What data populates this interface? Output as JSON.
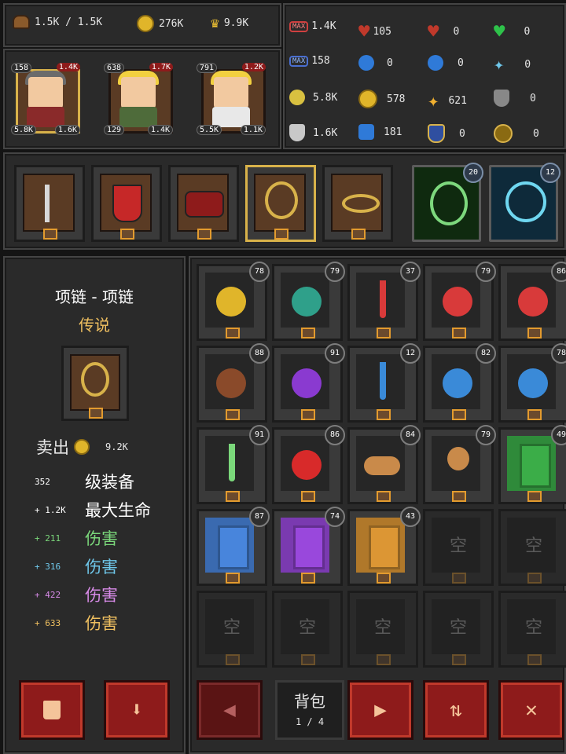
{
  "resources": {
    "capacity": "1.5K / 1.5K",
    "gold": "276K",
    "crown": "9.9K"
  },
  "heroes": [
    {
      "level": "158",
      "hp": "1.4K",
      "stat_left": "5.8K",
      "stat_right": "1.6K",
      "selected": true
    },
    {
      "level": "638",
      "hp": "1.7K",
      "stat_left": "129",
      "stat_right": "1.4K",
      "selected": false
    },
    {
      "level": "791",
      "hp": "1.2K",
      "stat_left": "5.5K",
      "stat_right": "1.1K",
      "selected": false
    }
  ],
  "stats": {
    "row1": [
      "1.4K",
      "105",
      "0",
      "0"
    ],
    "row2": [
      "158",
      "0",
      "0",
      "0"
    ],
    "row3": [
      "5.8K",
      "578",
      "621",
      "0"
    ],
    "row4": [
      "1.6K",
      "181",
      "0",
      "0"
    ]
  },
  "skills": [
    {
      "level": "20"
    },
    {
      "level": "12"
    }
  ],
  "detail": {
    "name": "项链 - 项链",
    "rarity": "传说",
    "sell_label": "卖出",
    "sell_value": "9.2K",
    "lines": [
      {
        "value": "352",
        "name": "级装备",
        "color": "#ffffff"
      },
      {
        "value": "+ 1.2K",
        "name": "最大生命",
        "color": "#ffffff"
      },
      {
        "value": "+ 211",
        "name": "伤害",
        "color": "#7bd87b"
      },
      {
        "value": "+ 316",
        "name": "伤害",
        "color": "#6fc7ea"
      },
      {
        "value": "+ 422",
        "name": "伤害",
        "color": "#d88be8"
      },
      {
        "value": "+ 633",
        "name": "伤害",
        "color": "#f0c060"
      }
    ]
  },
  "inventory": {
    "empty_label": "空",
    "bag_label": "背包",
    "page": "1 / 4",
    "items": [
      {
        "count": "78",
        "kind": "potion-yellow"
      },
      {
        "count": "79",
        "kind": "potion-teal"
      },
      {
        "count": "37",
        "kind": "tube-red"
      },
      {
        "count": "79",
        "kind": "potion-red"
      },
      {
        "count": "86",
        "kind": "flask-red"
      },
      {
        "count": "88",
        "kind": "potion-brown"
      },
      {
        "count": "91",
        "kind": "potion-purple"
      },
      {
        "count": "12",
        "kind": "tube-blue"
      },
      {
        "count": "82",
        "kind": "potion-blue"
      },
      {
        "count": "78",
        "kind": "flask-blue"
      },
      {
        "count": "91",
        "kind": "tube-green"
      },
      {
        "count": "86",
        "kind": "apple"
      },
      {
        "count": "84",
        "kind": "bread"
      },
      {
        "count": "79",
        "kind": "drumstick"
      },
      {
        "count": "49",
        "kind": "gem-green"
      },
      {
        "count": "87",
        "kind": "gem-blue"
      },
      {
        "count": "74",
        "kind": "gem-purple"
      },
      {
        "count": "43",
        "kind": "gem-orange"
      }
    ]
  }
}
